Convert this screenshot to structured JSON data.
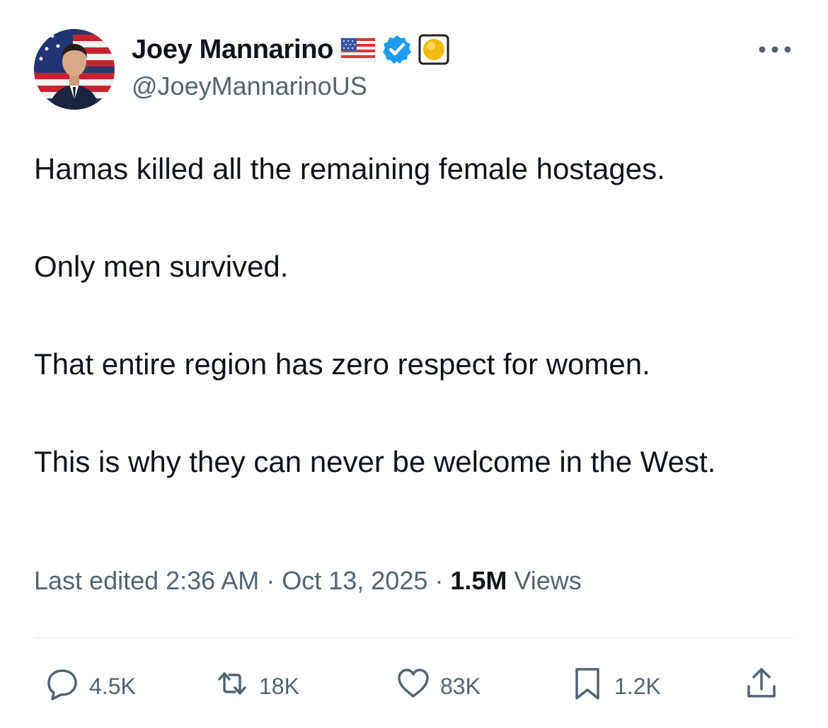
{
  "author": {
    "display_name": "Joey Mannarino",
    "handle": "@JoeyMannarinoUS",
    "badges": [
      "us-flag-emoji",
      "verified-checkmark",
      "affiliate-badge"
    ]
  },
  "tweet": {
    "paragraphs": [
      "Hamas killed all the remaining female hostages.",
      "Only men survived.",
      "That entire region has zero respect for women.",
      "This is why they can never be welcome in the West."
    ]
  },
  "meta": {
    "edited_label": "Last edited 2:36 AM",
    "date": "Oct 13, 2025",
    "views_count": "1.5M",
    "views_label": "Views",
    "separator": "·"
  },
  "actions": {
    "replies": "4.5K",
    "reposts": "18K",
    "likes": "83K",
    "bookmarks": "1.2K"
  },
  "colors": {
    "text": "#0f1419",
    "secondary": "#536471",
    "verified": "#1d9bf0",
    "divider": "#eff3f4"
  }
}
